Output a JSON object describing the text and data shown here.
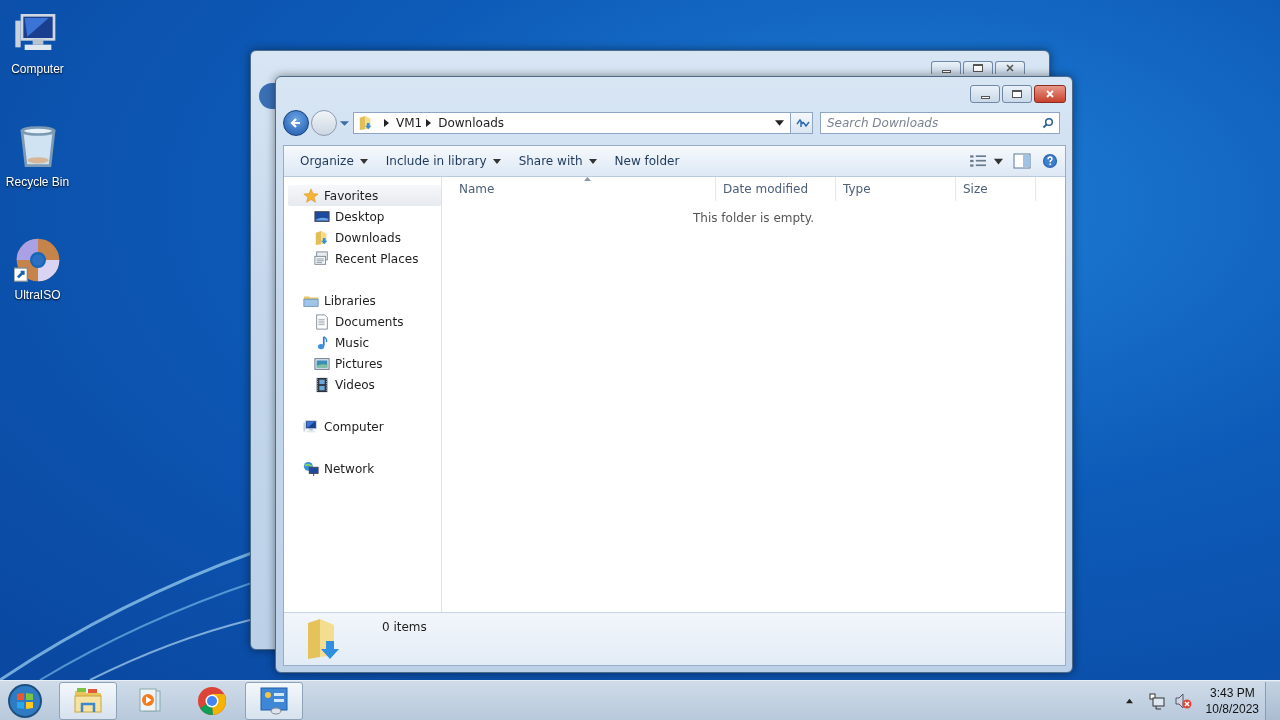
{
  "desktop_icons": [
    {
      "label": "Computer",
      "kind": "computer"
    },
    {
      "label": "Recycle Bin",
      "kind": "recycle"
    },
    {
      "label": "UltraISO",
      "kind": "disc"
    }
  ],
  "window": {
    "address": {
      "path": [
        "VM1",
        "Downloads"
      ]
    },
    "search": {
      "placeholder": "Search Downloads"
    },
    "toolbar": [
      {
        "label": "Organize",
        "dropdown": true
      },
      {
        "label": "Include in library",
        "dropdown": true
      },
      {
        "label": "Share with",
        "dropdown": true
      },
      {
        "label": "New folder",
        "dropdown": false
      }
    ],
    "navigation": [
      {
        "label": "Favorites",
        "kind": "star",
        "selected": true,
        "children": [
          {
            "label": "Desktop",
            "kind": "desktop",
            "selected": false
          },
          {
            "label": "Downloads",
            "kind": "download",
            "selected": false
          },
          {
            "label": "Recent Places",
            "kind": "recent",
            "selected": false
          }
        ]
      },
      {
        "label": "Libraries",
        "kind": "library",
        "selected": false,
        "children": [
          {
            "label": "Documents",
            "kind": "document",
            "selected": false
          },
          {
            "label": "Music",
            "kind": "music",
            "selected": false
          },
          {
            "label": "Pictures",
            "kind": "pictures",
            "selected": false
          },
          {
            "label": "Videos",
            "kind": "videos",
            "selected": false
          }
        ]
      },
      {
        "label": "Computer",
        "kind": "computer",
        "selected": false
      },
      {
        "label": "Network",
        "kind": "network",
        "selected": false
      }
    ],
    "columns": [
      {
        "label": "Name",
        "sorted": true
      },
      {
        "label": "Date modified",
        "sorted": false
      },
      {
        "label": "Type",
        "sorted": false
      },
      {
        "label": "Size",
        "sorted": false
      }
    ],
    "empty_message": "This folder is empty.",
    "status": {
      "count": "0 items"
    }
  },
  "taskbar": {
    "items": [
      {
        "kind": "explorer",
        "active": true
      },
      {
        "kind": "media",
        "active": false
      },
      {
        "kind": "chrome",
        "active": false
      },
      {
        "kind": "control",
        "active": true
      }
    ],
    "clock": {
      "time": "3:43 PM",
      "date": "10/8/2023"
    }
  }
}
